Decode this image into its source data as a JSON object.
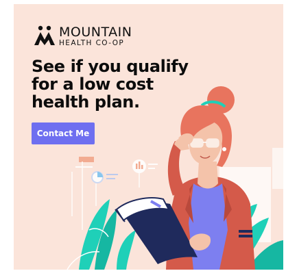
{
  "ad": {
    "brand": {
      "name": "MOUNTAIN",
      "subtitle": "HEALTH CO-OP",
      "icon": "mountain-people-logo"
    },
    "headline": "See if you qualify for a low cost health plan.",
    "cta_label": "Contact Me",
    "colors": {
      "background": "#fbe4da",
      "cta": "#6e6ff0",
      "hair": "#e8745e",
      "jacket": "#d45a4a",
      "shirt": "#7d7ff0",
      "leaves": "#1fd0b8",
      "folder": "#1f2a5c"
    },
    "illustration": "woman-adjusting-glasses-holding-clipboard"
  }
}
